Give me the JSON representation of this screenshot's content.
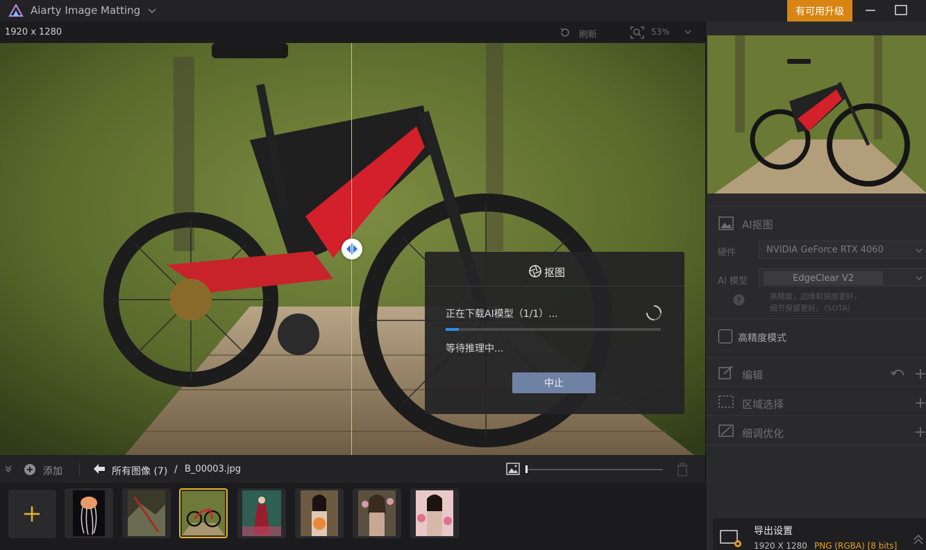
{
  "app": {
    "title": "Aiarty Image Matting",
    "upgrade_label": "有可用升级"
  },
  "toolbar": {
    "image_size": "1920 x 1280",
    "refresh_label": "刷新",
    "zoom_level": "53%"
  },
  "dialog": {
    "title": "抠图",
    "download_status": "正在下载AI模型（1/1）...",
    "wait_status": "等待推理中...",
    "progress_fraction": 0.06,
    "stop_label": "中止"
  },
  "bottom_bar": {
    "add_label": "添加",
    "all_images": "所有图像 (7)",
    "separator": "/",
    "current_file": "B_00003.jpg",
    "thumb_size_fraction": 0.0
  },
  "thumbnails": [
    {
      "name": "jellyfish",
      "selected": false
    },
    {
      "name": "forest-rocks",
      "selected": false
    },
    {
      "name": "bicycle",
      "selected": true
    },
    {
      "name": "woman-red-dress",
      "selected": false
    },
    {
      "name": "woman-flowers-1",
      "selected": false
    },
    {
      "name": "woman-flowers-2",
      "selected": false
    },
    {
      "name": "woman-flowers-3",
      "selected": false
    }
  ],
  "panel": {
    "ai_matting_title": "AI抠图",
    "hardware_label": "硬件",
    "hardware_value": "NVIDIA GeForce RTX 4060",
    "model_label": "AI 模型",
    "model_value": "EdgeClear  V2",
    "model_desc_1": "高精度，边缘和锐度更好，",
    "model_desc_2": "细节保留更好。（SOTA）",
    "high_precision_label": "高精度模式",
    "edit_title": "编辑",
    "region_title": "区域选择",
    "refine_title": "细调优化"
  },
  "export": {
    "title": "导出设置",
    "size": "1920 X 1280",
    "format": "PNG (RGBA) [8 bits]"
  },
  "colors": {
    "accent": "#d98514",
    "progress": "#2a8ee6",
    "selected_border": "#e8b22a",
    "split_line": "#e6c830",
    "format_text": "#e3a21e"
  }
}
